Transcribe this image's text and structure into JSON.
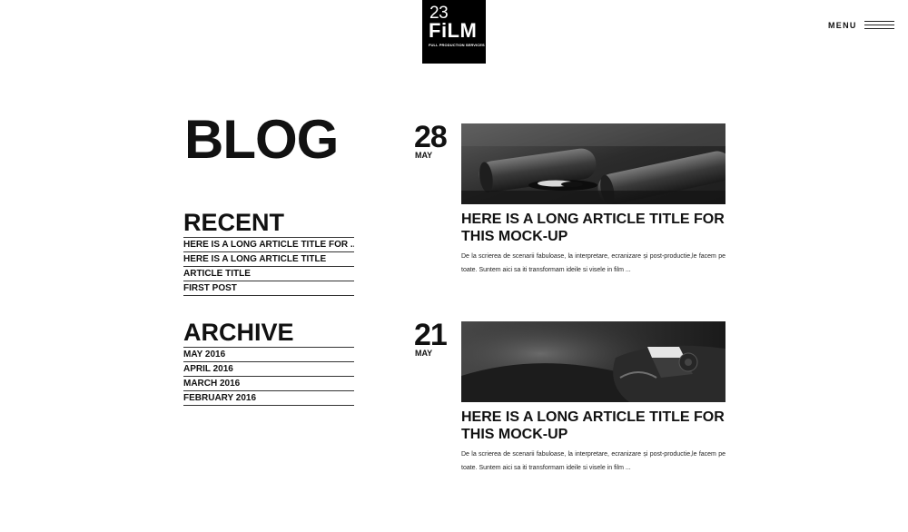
{
  "header": {
    "logo": {
      "number": "23",
      "name": "FiLM",
      "tagline": "FULL PRODUCTION SERVICES"
    },
    "menu_label": "MENU"
  },
  "page_title": "BLOG",
  "recent": {
    "heading": "RECENT",
    "items": [
      "HERE IS A LONG ARTICLE TITLE FOR ...",
      "HERE IS A LONG ARTICLE TITLE",
      "ARTICLE TITLE",
      "FIRST POST"
    ]
  },
  "archive": {
    "heading": "ARCHIVE",
    "items": [
      "MAY 2016",
      "APRIL 2016",
      "MARCH 2016",
      "FEBRUARY 2016"
    ]
  },
  "posts": [
    {
      "day": "28",
      "month": "MAY",
      "title": "HERE IS A LONG ARTICLE TITLE FOR THIS MOCK-UP",
      "excerpt": "De la scrierea de scenarii fabuloase, la interpretare, ecranizare și post-productie,le facem pe toate. Suntem aici sa iti transformam ideile si visele in film ...",
      "image": "film-equipment-photo"
    },
    {
      "day": "21",
      "month": "MAY",
      "title": "HERE IS A LONG ARTICLE TITLE FOR THIS MOCK-UP",
      "excerpt": "De la scrierea de scenarii fabuloase, la interpretare, ecranizare și post-productie,le facem pe toate. Suntem aici sa iti transformam ideile si visele in film ...",
      "image": "camera-detail-photo"
    }
  ],
  "colors": {
    "text": "#111111",
    "logo_bg": "#000000",
    "page_bg": "#ffffff"
  }
}
